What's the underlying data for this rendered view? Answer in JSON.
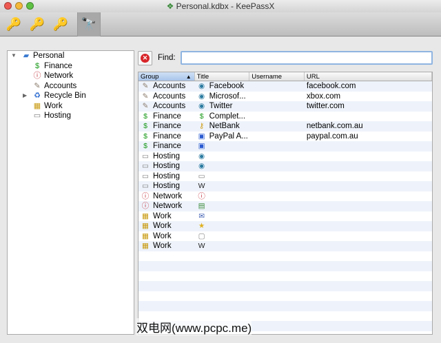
{
  "window": {
    "title": "Personal.kdbx - KeePassX"
  },
  "toolbar": {
    "buttons": [
      {
        "name": "add-entry",
        "icon": "key-add-icon",
        "glyph": "🔑"
      },
      {
        "name": "edit-entry",
        "icon": "key-edit-icon",
        "glyph": "🔑"
      },
      {
        "name": "delete-entry",
        "icon": "key-delete-icon",
        "glyph": "🔑"
      },
      {
        "name": "search",
        "icon": "binoculars-icon",
        "glyph": "🔭"
      }
    ]
  },
  "tree": {
    "root": "Personal",
    "groups": [
      {
        "label": "Finance",
        "icon": "$",
        "color": "#1a9a1a"
      },
      {
        "label": "Network",
        "icon": "ⓘ",
        "color": "#c0303a"
      },
      {
        "label": "Accounts",
        "icon": "✎",
        "color": "#8a7a6a"
      },
      {
        "label": "Recycle Bin",
        "icon": "♻",
        "color": "#2a6ad0"
      },
      {
        "label": "Work",
        "icon": "▦",
        "color": "#c89a10"
      },
      {
        "label": "Hosting",
        "icon": "▭",
        "color": "#777"
      }
    ]
  },
  "find": {
    "label": "Find:",
    "value": "",
    "clear_glyph": "✕"
  },
  "columns": [
    "Group",
    "Title",
    "Username",
    "URL"
  ],
  "sort_arrow": "▲",
  "rows": [
    {
      "group": "Accounts",
      "gicon": "✎",
      "gcolor": "#8a7a6a",
      "title": "Facebook",
      "ticon": "◉",
      "tcolor": "#2a7aa0",
      "username": "",
      "url": "facebook.com"
    },
    {
      "group": "Accounts",
      "gicon": "✎",
      "gcolor": "#8a7a6a",
      "title": "Microsof...",
      "ticon": "◉",
      "tcolor": "#2a7aa0",
      "username": "",
      "url": "xbox.com"
    },
    {
      "group": "Accounts",
      "gicon": "✎",
      "gcolor": "#8a7a6a",
      "title": "Twitter",
      "ticon": "◉",
      "tcolor": "#2a7aa0",
      "username": "",
      "url": "twitter.com"
    },
    {
      "group": "Finance",
      "gicon": "$",
      "gcolor": "#1a9a1a",
      "title": "Complet...",
      "ticon": "$",
      "tcolor": "#1a9a1a",
      "username": "",
      "url": ""
    },
    {
      "group": "Finance",
      "gicon": "$",
      "gcolor": "#1a9a1a",
      "title": "NetBank",
      "ticon": "⚷",
      "tcolor": "#d0a020",
      "username": "",
      "url": "netbank.com.au"
    },
    {
      "group": "Finance",
      "gicon": "$",
      "gcolor": "#1a9a1a",
      "title": "PayPal A...",
      "ticon": "▣",
      "tcolor": "#2a5ad0",
      "username": "",
      "url": "paypal.com.au"
    },
    {
      "group": "Finance",
      "gicon": "$",
      "gcolor": "#1a9a1a",
      "title": "",
      "ticon": "▣",
      "tcolor": "#2a5ad0",
      "username": "",
      "url": ""
    },
    {
      "group": "Hosting",
      "gicon": "▭",
      "gcolor": "#777",
      "title": "",
      "ticon": "◉",
      "tcolor": "#2a7aa0",
      "username": "",
      "url": ""
    },
    {
      "group": "Hosting",
      "gicon": "▭",
      "gcolor": "#777",
      "title": "",
      "ticon": "◉",
      "tcolor": "#2a7aa0",
      "username": "",
      "url": ""
    },
    {
      "group": "Hosting",
      "gicon": "▭",
      "gcolor": "#777",
      "title": "",
      "ticon": "▭",
      "tcolor": "#777",
      "username": "",
      "url": ""
    },
    {
      "group": "Hosting",
      "gicon": "▭",
      "gcolor": "#777",
      "title": "",
      "ticon": "W",
      "tcolor": "#222",
      "username": "",
      "url": ""
    },
    {
      "group": "Network",
      "gicon": "ⓘ",
      "gcolor": "#c0303a",
      "title": "",
      "ticon": "ⓘ",
      "tcolor": "#c0303a",
      "username": "",
      "url": ""
    },
    {
      "group": "Network",
      "gicon": "ⓘ",
      "gcolor": "#c0303a",
      "title": "",
      "ticon": "▤",
      "tcolor": "#3a8a3a",
      "username": "",
      "url": ""
    },
    {
      "group": "Work",
      "gicon": "▦",
      "gcolor": "#c89a10",
      "title": "",
      "ticon": "✉",
      "tcolor": "#3a5ab0",
      "username": "",
      "url": ""
    },
    {
      "group": "Work",
      "gicon": "▦",
      "gcolor": "#c89a10",
      "title": "",
      "ticon": "★",
      "tcolor": "#e0b020",
      "username": "",
      "url": ""
    },
    {
      "group": "Work",
      "gicon": "▦",
      "gcolor": "#c89a10",
      "title": "",
      "ticon": "▢",
      "tcolor": "#888",
      "username": "",
      "url": ""
    },
    {
      "group": "Work",
      "gicon": "▦",
      "gcolor": "#c89a10",
      "title": "",
      "ticon": "W",
      "tcolor": "#222",
      "username": "",
      "url": ""
    }
  ],
  "watermark": "双电网(www.pcpc.me)"
}
